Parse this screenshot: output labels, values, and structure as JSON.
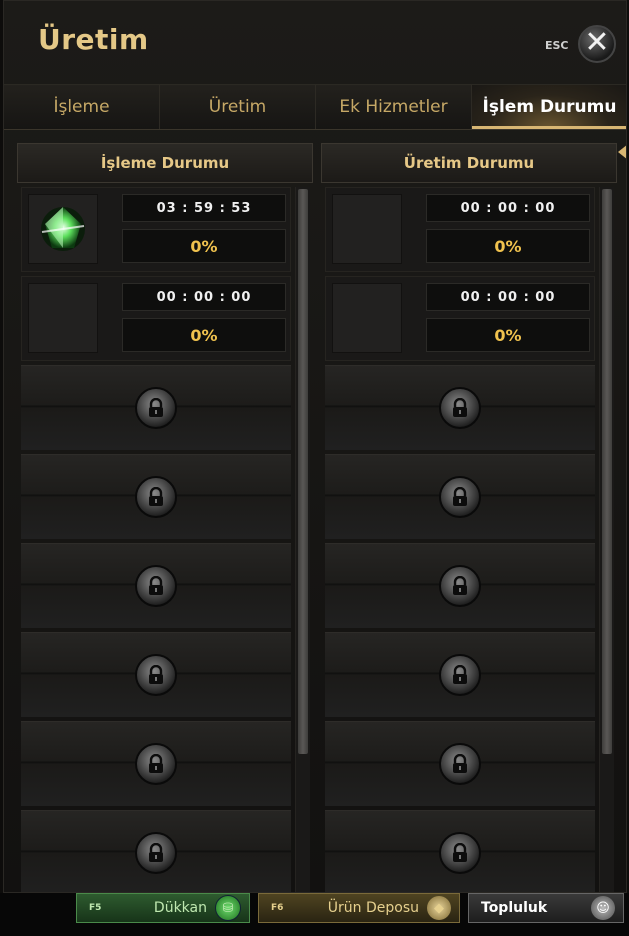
{
  "window": {
    "title": "Üretim",
    "esc_label": "ESC",
    "close_glyph": "✕"
  },
  "tabs": [
    {
      "label": "İşleme",
      "active": false
    },
    {
      "label": "Üretim",
      "active": false
    },
    {
      "label": "Ek Hizmetler",
      "active": false
    },
    {
      "label": "İşlem Durumu",
      "active": true
    }
  ],
  "left_panel": {
    "header": "İşleme Durumu",
    "active_slots": [
      {
        "timer": "03 : 59 : 53",
        "progress": "0%",
        "item_icon": "green-crystal-icon"
      },
      {
        "timer": "00 : 00 : 00",
        "progress": "0%",
        "item_icon": "empty"
      }
    ],
    "locked_slot_count": 6
  },
  "right_panel": {
    "header": "Üretim Durumu",
    "active_slots": [
      {
        "timer": "00 : 00 : 00",
        "progress": "0%",
        "item_icon": "empty"
      },
      {
        "timer": "00 : 00 : 00",
        "progress": "0%",
        "item_icon": "empty"
      }
    ],
    "locked_slot_count": 6
  },
  "bottom_bar": {
    "shop": {
      "key": "F5",
      "label": "Dükkan"
    },
    "storage": {
      "key": "F6",
      "label": "Ürün Deposu"
    },
    "community": {
      "label": "Topluluk"
    }
  },
  "colors": {
    "gold": "#e4c887",
    "progress": "#f0c24e",
    "shop_green": "#2e5b2f",
    "storage_gold": "#4f4421"
  }
}
